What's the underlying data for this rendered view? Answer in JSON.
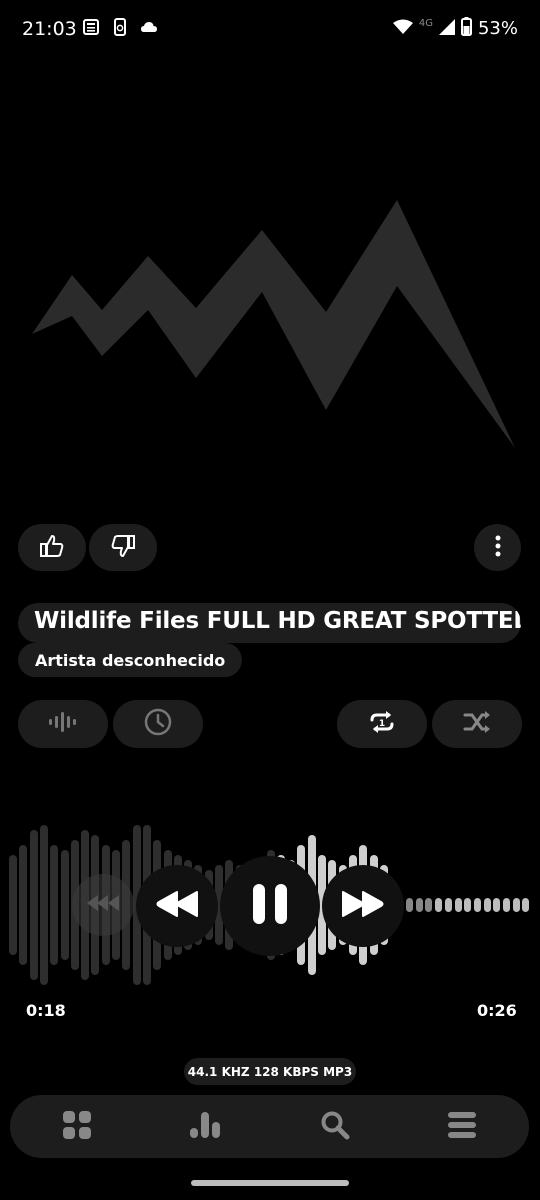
{
  "status_bar": {
    "time": "21:03",
    "left_icons": [
      "news-icon",
      "phone-update-icon",
      "cloud-icon"
    ],
    "network_label": "4G",
    "battery_text": "53%"
  },
  "player": {
    "title": "Wildlife Files FULL HD GREAT SPOTTED",
    "artist": "Artista desconhecido",
    "elapsed": "0:18",
    "total": "0:26",
    "progress_fraction": 0.69,
    "format": {
      "rate": "44.1 KHZ",
      "bitrate": "128 KBPS",
      "codec": "MP3"
    }
  },
  "buttons": {
    "like": "thumb-up-icon",
    "dislike": "thumb-down-icon",
    "more": "more-vertical-icon",
    "visualizer": "waveform-icon",
    "sleep_timer": "clock-icon",
    "repeat": "repeat-one-icon",
    "shuffle": "shuffle-icon"
  },
  "nav": [
    "grid-icon",
    "equalizer-icon",
    "search-icon",
    "menu-icon"
  ],
  "colors": {
    "background": "#000000",
    "surface": "#1d1d1d",
    "text": "#ffffff"
  }
}
